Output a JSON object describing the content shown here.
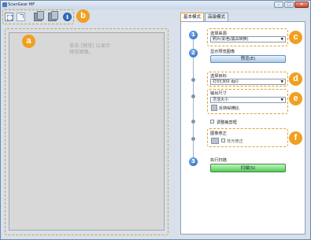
{
  "window": {
    "title": "ScanGear MF",
    "minimize_glyph": "–",
    "maximize_glyph": "□",
    "close_glyph": "✕"
  },
  "toolbar": {
    "icons": [
      "crop-icon",
      "rotate-icon",
      "copy-icon",
      "multi-copy-icon",
      "info-icon"
    ],
    "info_glyph": "i"
  },
  "callouts": {
    "a": "a",
    "b": "b",
    "c": "c",
    "d": "d",
    "e": "e",
    "f": "f"
  },
  "preview": {
    "hint_text": "单击 [预览] 以显示\n预览图像。"
  },
  "tabs": [
    {
      "label": "基本模式",
      "active": true
    },
    {
      "label": "高级模式",
      "active": false
    }
  ],
  "steps": {
    "one": "1",
    "two": "2",
    "three": "3"
  },
  "panel": {
    "select_source_label": "选择来源",
    "select_source_value": "照片(彩色/黑白转换)",
    "preview_section_label": "显示预览图像",
    "preview_button": "预览(E)",
    "destination_label": "选择目标",
    "destination_value": "打印(300 dpi)",
    "output_size_label": "输出尺寸",
    "output_size_value": "灵活大小",
    "invert_label": "反转纵横比",
    "adjust_crop_label": "调整裁剪框",
    "image_correction_label": "图像修正",
    "backlight_label": "背光修正",
    "run_scan_label": "执行扫描",
    "scan_button": "扫描(S)"
  },
  "colors": {
    "callout": "#f0a020",
    "highlight_dash": "#e0a030",
    "step": "#1f5fb8",
    "scan_button": "#4fcd56"
  }
}
